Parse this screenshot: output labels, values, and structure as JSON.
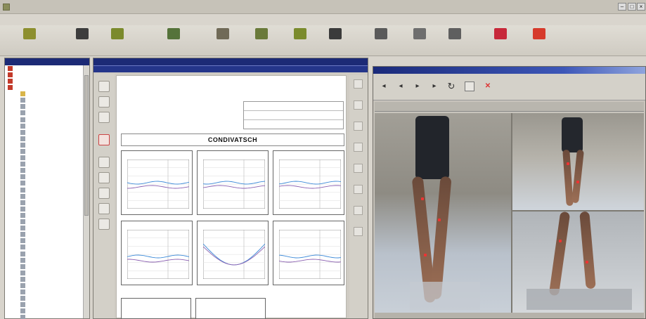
{
  "window": {
    "title": ""
  },
  "menu": [],
  "toolbar": {
    "buttons": [
      {
        "label": "",
        "icon": "pencil-icon",
        "color": "#8d8f2f"
      },
      {
        "label": "",
        "icon": "save-icon",
        "color": "#3d3d3d"
      },
      {
        "label": "",
        "icon": "data-icon",
        "color": "#7b8a2c"
      },
      {
        "label": "",
        "icon": "tool-icon",
        "color": "#55733a"
      },
      {
        "label": "",
        "icon": "chart-icon",
        "color": "#706a57"
      },
      {
        "label": "",
        "icon": "report-icon",
        "color": "#6a7a3a"
      },
      {
        "label": "",
        "icon": "export-icon",
        "color": "#7b8b2d"
      },
      {
        "label": "",
        "icon": "print-icon",
        "color": "#3b3b3b"
      },
      {
        "label": "",
        "icon": "video-icon",
        "color": "#5a5a5a"
      },
      {
        "label": "",
        "icon": "document-icon",
        "color": "#6e6e6e"
      },
      {
        "label": "",
        "icon": "clipboard-icon",
        "color": "#5f5f5f"
      },
      {
        "label": "",
        "icon": "help-icon",
        "color": "#c7283a"
      },
      {
        "label": "",
        "icon": "exit-icon",
        "color": "#d63a2b"
      }
    ]
  },
  "tree": {
    "header": "",
    "rows": [
      "",
      "",
      "",
      "",
      "",
      "",
      "",
      "",
      "",
      "",
      "",
      "",
      "",
      "",
      "",
      "",
      "",
      "",
      "",
      "",
      "",
      "",
      "",
      "",
      "",
      "",
      "",
      "",
      "",
      "",
      "",
      "",
      "",
      "",
      "",
      "",
      "",
      "",
      "",
      ""
    ]
  },
  "document": {
    "caption1": "",
    "caption2": "",
    "info_rows": [
      {
        "key": "",
        "value": ""
      },
      {
        "key": "",
        "value": ""
      },
      {
        "key": "",
        "value": ""
      }
    ],
    "report_title": "CONDIVATSCH",
    "charts": [
      {
        "title": "",
        "unit": "",
        "foot": ""
      },
      {
        "title": "",
        "unit": "",
        "foot": ""
      },
      {
        "title": "",
        "unit": "",
        "foot": ""
      },
      {
        "title": "",
        "unit": "",
        "foot": ""
      },
      {
        "title": "",
        "unit": "",
        "foot": ""
      },
      {
        "title": "",
        "unit": "",
        "foot": ""
      }
    ],
    "bottom_boxes": [
      {
        "title": "",
        "sub": ""
      },
      {
        "title": "",
        "sub": ""
      }
    ]
  },
  "video": {
    "caption": ""
  },
  "colors": {
    "caption": "#1c2a76",
    "tree_node": "#c33a2a",
    "line_blue": "#3c8ad8",
    "line_purple": "#8a5fb0"
  }
}
